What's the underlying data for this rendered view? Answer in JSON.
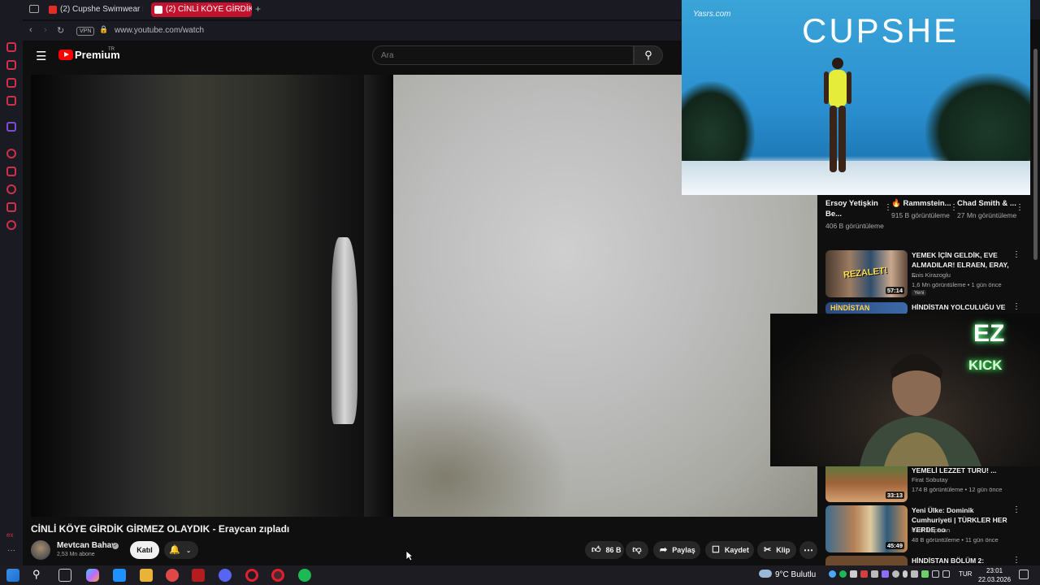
{
  "browser": {
    "tabs": [
      {
        "label": "(2) Cupshe Swimwear Fas"
      },
      {
        "label": "(2) CİNLİ KÖYE GİRDİK"
      }
    ],
    "new_tab_icon": "plus-icon",
    "vpn_label": "VPN",
    "url": "www.youtube.com/watch"
  },
  "youtube": {
    "logo_text": "Premium",
    "logo_badge": "TR",
    "search_placeholder": "Ara"
  },
  "video": {
    "title": "CİNLİ KÖYE GİRDİK GİRMEZ OLAYDIK - Eraycan zıpladı",
    "channel": "Mevtcan Bahav",
    "subscribers": "2,53 Mn abone",
    "join_label": "Katıl",
    "likes": "86 B",
    "share_label": "Paylaş",
    "save_label": "Kaydet",
    "clip_label": "Klip"
  },
  "shorts": [
    {
      "title": "Ersoy Yetişkin Be...",
      "views": "406 B görüntüleme"
    },
    {
      "title": "🔥 Rammstein...",
      "views": "915 B görüntüleme"
    },
    {
      "title": "Chad Smith & ...",
      "views": "27 Mn görüntüleme"
    }
  ],
  "recommendations": [
    {
      "title": "YEMEK İÇİN GELDİK, EVE ALMADILAR! ELRAEN, ERAY, ...",
      "channel": "Enis Kirazoglu",
      "stats": "1,6 Mn görüntüleme • 1 gün önce",
      "badge": "Yeni",
      "duration": "57:14",
      "thumb_text": "REZALET!"
    },
    {
      "title": "HİNDİSTAN YOLCULUĞU VE",
      "channel": "",
      "stats": "",
      "badge": "",
      "duration": "",
      "thumb_text": "HİNDİSTAN"
    },
    {
      "title": "YEMELİ LEZZET TURU! ...",
      "channel": "Firat Sobutay",
      "stats": "174 B görüntüleme • 12 gün önce",
      "badge": "",
      "duration": "33:13",
      "thumb_text": ""
    },
    {
      "title": "Yeni Ülke: Dominik Cumhuriyeti | TÜRKLER HER YERDE ᴅᴏ",
      "channel": "Fatih Koparan",
      "stats": "48 B görüntüleme • 11 gün önce",
      "badge": "",
      "duration": "45:49",
      "thumb_text": ""
    },
    {
      "title": "HİNDİSTAN BÖLÜM 2:",
      "channel": "",
      "stats": "",
      "badge": "",
      "duration": "",
      "thumb_text": ""
    }
  ],
  "pip_cupshe": {
    "brand": "CUPSHE",
    "watermark": "Yasrs.com"
  },
  "pip_kick": {
    "ez": "EZ",
    "kick": "KICK"
  },
  "taskbar": {
    "weather": "9°C  Bulutlu",
    "lang": "TUR",
    "time": "23:01",
    "date": "22.03.2026"
  },
  "colors": {
    "accent": "#c3122e",
    "youtube_red": "#ff0000",
    "bg": "#0f0f0f"
  }
}
